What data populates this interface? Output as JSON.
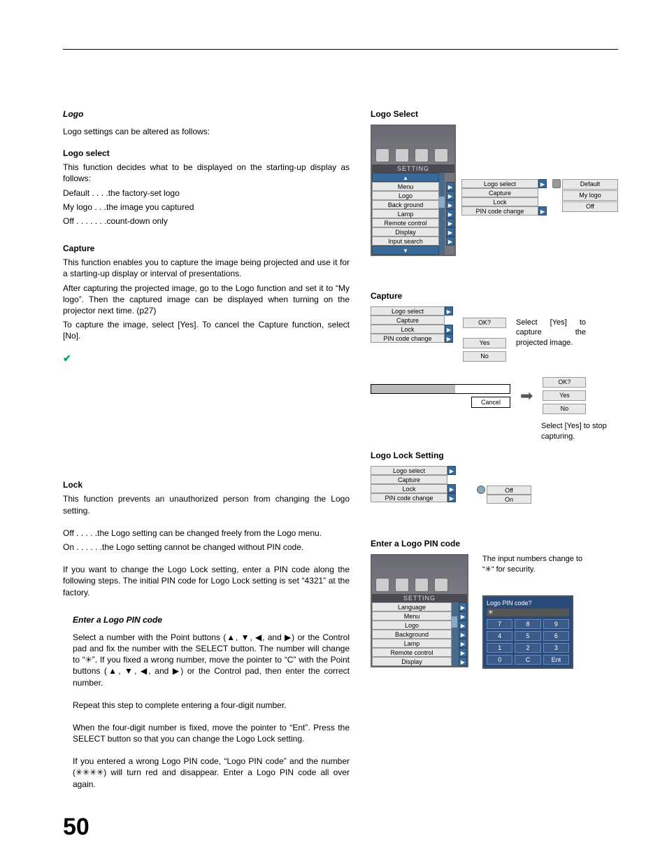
{
  "page_number": "50",
  "left": {
    "logo_heading": "Logo",
    "logo_intro": "Logo settings can be altered as follows:",
    "logo_select_heading": "Logo select",
    "logo_select_intro": "This function decides what to be displayed on the starting-up display as follows:",
    "logo_select_default": "Default  . . . .the factory-set logo",
    "logo_select_mylogo": "My logo  . . .the image you captured",
    "logo_select_off": "Off  . . . . . . .count-down only",
    "capture_heading": "Capture",
    "capture_p1": "This function enables you to capture the image being projected and use it for a starting-up display or interval of presentations.",
    "capture_p2": "After capturing the projected image, go to the Logo function and set it to “My logo”. Then the captured image can be displayed when turning on the projector next time. (p27)",
    "capture_p3": "To capture the image, select [Yes]. To cancel the Capture function, select [No].",
    "checkmark": "✔",
    "lock_heading": "Lock",
    "lock_intro": "This function prevents an unauthorized person from changing the Logo setting.",
    "lock_off": "Off   . . . . .the Logo setting can be changed freely from the Logo menu.",
    "lock_on": "On . . . . . .the Logo setting cannot be changed without PIN code.",
    "lock_p2": "If you want to change the Logo Lock setting, enter a PIN code along the following steps. The initial PIN code for Logo Lock setting is set “4321” at the factory.",
    "enter_pin_heading": "Enter a Logo PIN code",
    "enter_pin_p1": "Select a number with the Point buttons (▲, ▼, ◀, and ▶) or the Control pad and fix the number with the SELECT button. The number will change to “✳”. If you fixed a wrong number, move the pointer to “C” with the Point buttons (▲, ▼, ◀, and ▶) or the Control pad, then enter the correct number.",
    "enter_pin_p2": "Repeat this step to complete entering a four-digit number.",
    "enter_pin_p3": "When the four-digit number is fixed, move the pointer to “Ent”. Press the SELECT button so that you can change the Logo Lock setting.",
    "enter_pin_p4": "If you entered a wrong Logo PIN code, “Logo PIN code” and the number (✳✳✳✳) will turn red and disappear. Enter a Logo PIN code all over again."
  },
  "right": {
    "logo_select_title": "Logo Select",
    "setting_label": "SETTING",
    "main_menu": [
      "Menu",
      "Logo",
      "Back ground",
      "Lamp",
      "Remote control",
      "Display",
      "Input search"
    ],
    "logo_submenu": [
      "Logo select",
      "Capture",
      "Lock",
      "PIN code change"
    ],
    "logo_options": [
      "Default",
      "My logo",
      "Off"
    ],
    "capture_title": "Capture",
    "capture_submenu": [
      "Logo select",
      "Capture",
      "Lock",
      "PIN code change"
    ],
    "capture_ok": "OK?",
    "capture_yes": "Yes",
    "capture_no": "No",
    "capture_caption1": "Select [Yes] to capture the projected image.",
    "cancel_label": "Cancel",
    "capture_ok2": "OK?",
    "capture_yes2": "Yes",
    "capture_no2": "No",
    "capture_caption2": "Select [Yes] to stop capturing.",
    "lock_title": "Logo Lock Setting",
    "lock_submenu": [
      "Logo select",
      "Capture",
      "Lock",
      "PIN code change"
    ],
    "lock_options": [
      "Off",
      "On"
    ],
    "pin_title": "Enter a Logo PIN code",
    "pin_menu": [
      "Language",
      "Menu",
      "Logo",
      "Background",
      "Lamp",
      "Remote control",
      "Display"
    ],
    "pin_caption": "The input numbers change to “✳” for security.",
    "pin_keypad_title": "Logo PIN code?",
    "pin_display": "✳",
    "pin_keys": [
      "7",
      "8",
      "9",
      "4",
      "5",
      "6",
      "1",
      "2",
      "3",
      "0",
      "C",
      "Ent"
    ]
  }
}
